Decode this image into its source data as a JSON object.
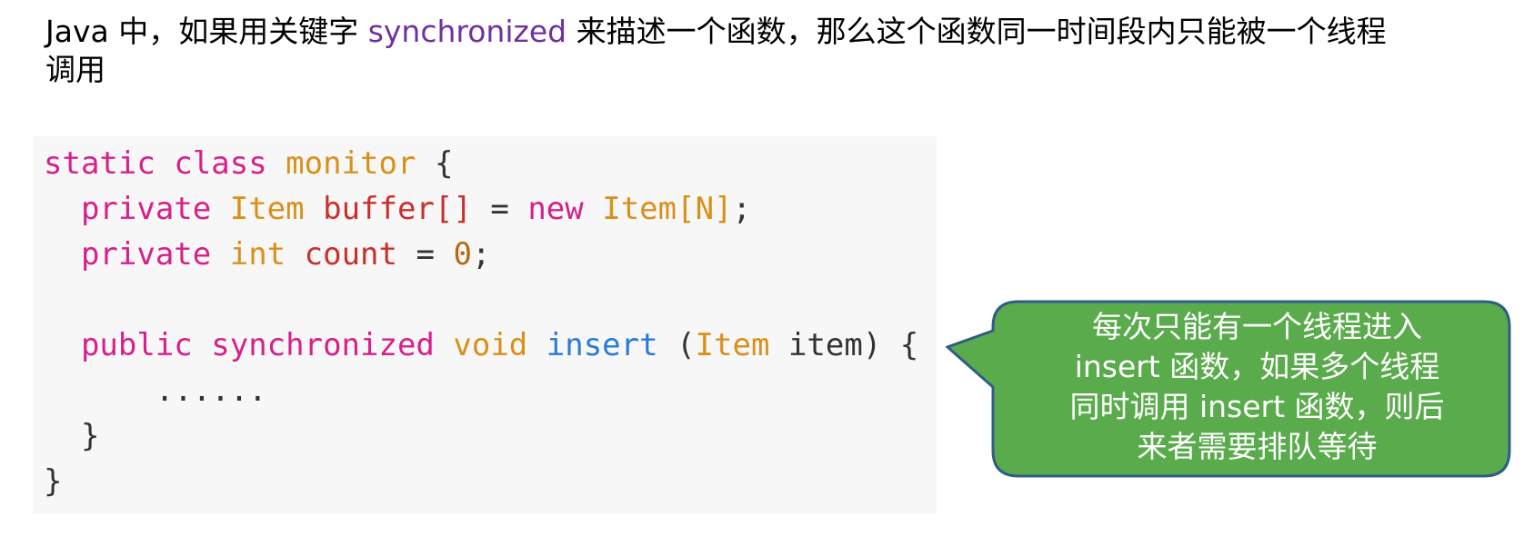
{
  "intro": {
    "part1": "Java 中，如果用关键字 ",
    "keyword": "synchronized",
    "part2": " 来描述一个函数，那么这个函数同一时间段内只能被一个线程",
    "line2": "调用"
  },
  "code": {
    "l1_static": "static",
    "l1_class": "class",
    "l1_name": "monitor",
    "l1_brace": "{",
    "l2_private": "private",
    "l2_type": "Item",
    "l2_var": "buffer[]",
    "l2_eq": "=",
    "l2_new": "new",
    "l2_type2": "Item[N]",
    "l2_semi": ";",
    "l3_private": "private",
    "l3_type": "int",
    "l3_var": "count",
    "l3_eq": "=",
    "l3_zero": "0",
    "l3_semi": ";",
    "l5_public": "public",
    "l5_sync": "synchronized",
    "l5_void": "void",
    "l5_fn": "insert",
    "l5_open": "(",
    "l5_type": "Item",
    "l5_arg": "item) {",
    "l6_dots": "......",
    "l7_close": "}",
    "l8_close": "}"
  },
  "callout": {
    "line1": "每次只能有一个线程进入",
    "line2": "insert 函数，如果多个线程",
    "line3": "同时调用 insert 函数，则后",
    "line4": "来者需要排队等待",
    "fill_color": "#5aab4c",
    "border_color": "#2e5d88"
  },
  "colors": {
    "keyword_inline": "#7030a0",
    "code_keyword": "#d7208a",
    "code_type": "#d9901a",
    "code_function": "#2a7ad8"
  }
}
